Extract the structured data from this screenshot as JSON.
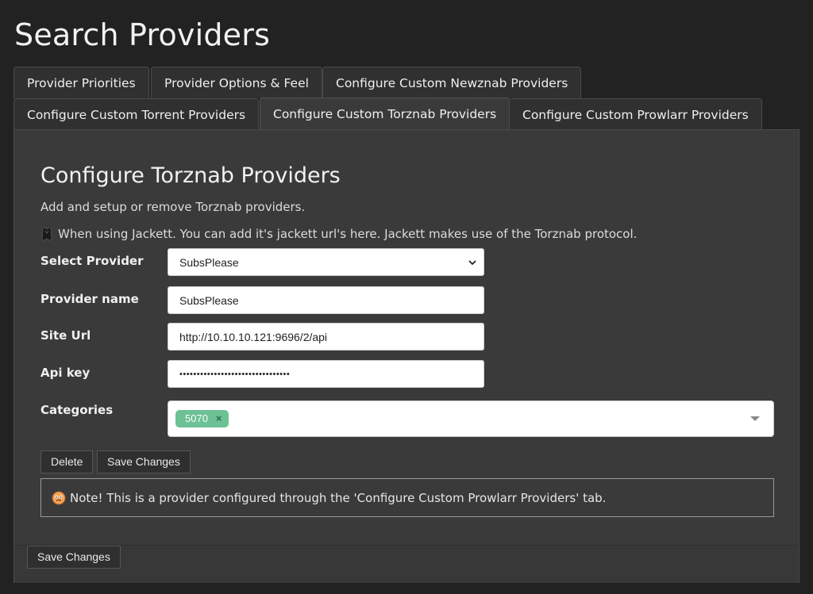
{
  "page": {
    "title": "Search Providers"
  },
  "tabs": [
    {
      "label": "Provider Priorities",
      "active": false
    },
    {
      "label": "Provider Options & Feel",
      "active": false
    },
    {
      "label": "Configure Custom Newznab Providers",
      "active": false
    },
    {
      "label": "Configure Custom Torrent Providers",
      "active": false
    },
    {
      "label": "Configure Custom Torznab Providers",
      "active": true
    },
    {
      "label": "Configure Custom Prowlarr Providers",
      "active": false
    }
  ],
  "section": {
    "title": "Configure Torznab Providers",
    "subtitle": "Add and setup or remove Torznab providers.",
    "hint": "When using Jackett. You can add it's jackett url's here. Jackett makes use of the Torznab protocol.",
    "hint_icon": "jackett-icon"
  },
  "form": {
    "select_provider": {
      "label": "Select Provider",
      "value": "SubsPlease"
    },
    "provider_name": {
      "label": "Provider name",
      "value": "SubsPlease"
    },
    "site_url": {
      "label": "Site Url",
      "value": "http://10.10.10.121:9696/2/api"
    },
    "api_key": {
      "label": "Api key",
      "value": "••••••••••••••••••••••••••••••••"
    },
    "categories": {
      "label": "Categories",
      "tags": [
        {
          "value": "5070",
          "color": "#6cc195"
        }
      ]
    }
  },
  "buttons": {
    "delete": "Delete",
    "save": "Save Changes",
    "save_bottom": "Save Changes"
  },
  "note": {
    "icon": "warning-face-icon",
    "text": "Note! This is a provider configured through the 'Configure Custom Prowlarr Providers' tab."
  },
  "colors": {
    "background": "#222222",
    "panel": "#3a3a3a",
    "tag": "#6cc195"
  }
}
